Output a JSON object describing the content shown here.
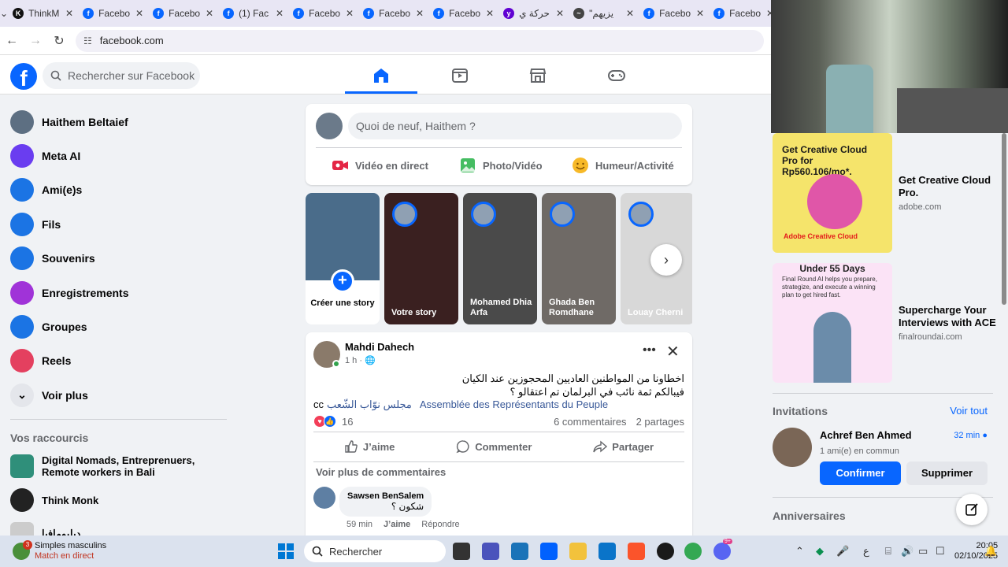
{
  "browser": {
    "tabs": [
      {
        "title": "ThinkM",
        "favicon_color": "#111111",
        "favicon_glyph": "K"
      },
      {
        "title": "Facebo",
        "favicon_color": "#0866ff",
        "favicon_glyph": "f"
      },
      {
        "title": "Facebo",
        "favicon_color": "#0866ff",
        "favicon_glyph": "f"
      },
      {
        "title": "(1) Fac",
        "favicon_color": "#0866ff",
        "favicon_glyph": "f"
      },
      {
        "title": "Facebo",
        "favicon_color": "#0866ff",
        "favicon_glyph": "f"
      },
      {
        "title": "Facebo",
        "favicon_color": "#0866ff",
        "favicon_glyph": "f"
      },
      {
        "title": "Facebo",
        "favicon_color": "#0866ff",
        "favicon_glyph": "f"
      },
      {
        "title": "حركة ي",
        "favicon_color": "#6001d2",
        "favicon_glyph": "y"
      },
      {
        "title": "\"يزيهم",
        "favicon_color": "#444444",
        "favicon_glyph": "~"
      },
      {
        "title": "Facebo",
        "favicon_color": "#0866ff",
        "favicon_glyph": "f"
      },
      {
        "title": "Facebo",
        "favicon_color": "#0866ff",
        "favicon_glyph": "f"
      }
    ],
    "url": "facebook.com"
  },
  "header": {
    "search_placeholder": "Rechercher sur Facebook",
    "nav": [
      "home-icon",
      "video-icon",
      "marketplace-icon",
      "gaming-icon"
    ]
  },
  "sidebar": {
    "items": [
      {
        "label": "Haithem Beltaief",
        "icon": "profile-avatar",
        "color": "#5d6f82"
      },
      {
        "label": "Meta AI",
        "icon": "meta-ai-icon",
        "color": "#6a3df0"
      },
      {
        "label": "Ami(e)s",
        "icon": "friends-icon",
        "color": "#1b74e4"
      },
      {
        "label": "Fils",
        "icon": "feeds-icon",
        "color": "#1b74e4"
      },
      {
        "label": "Souvenirs",
        "icon": "memories-icon",
        "color": "#1b74e4"
      },
      {
        "label": "Enregistrements",
        "icon": "saved-icon",
        "color": "#a033d8"
      },
      {
        "label": "Groupes",
        "icon": "groups-icon",
        "color": "#1b74e4"
      },
      {
        "label": "Reels",
        "icon": "reels-icon",
        "color": "#e4405f"
      },
      {
        "label": "Voir plus",
        "icon": "chevron-down-icon",
        "color": "#e4e6eb"
      }
    ],
    "shortcuts_title": "Vos raccourcis",
    "shortcuts": [
      {
        "label": "Digital Nomads, Entreprenuers, Remote workers in Bali",
        "color": "#2f8f7a"
      },
      {
        "label": "Think Monk",
        "color": "#222222"
      },
      {
        "label": "ديلبومافيا",
        "color": "#cccccc"
      }
    ]
  },
  "composer": {
    "placeholder": "Quoi de neuf, Haithem ?",
    "actions": [
      {
        "label": "Vidéo en direct",
        "icon": "live-video-icon",
        "color": "#e42645"
      },
      {
        "label": "Photo/Vidéo",
        "icon": "photo-icon",
        "color": "#45bd62"
      },
      {
        "label": "Humeur/Activité",
        "icon": "feeling-icon",
        "color": "#f7b928"
      }
    ]
  },
  "stories": {
    "create_label": "Créer une story",
    "items": [
      {
        "name": "Votre story",
        "bg": "#3a2020"
      },
      {
        "name": "Mohamed Dhia Arfa",
        "bg": "#4a4a4a"
      },
      {
        "name": "Ghada Ben Romdhane",
        "bg": "#6f6a66"
      },
      {
        "name": "Louay Cherni",
        "bg": "#d8d8d8"
      }
    ]
  },
  "post": {
    "author": "Mahdi Dahech",
    "time": "1 h · ",
    "text_line1": "اخطاونا من المواطنين العاديين المحجوزين عند الكيان",
    "text_line2": "فيبالكم ثمة نائب في البرلمان تم اعتقالو ؟",
    "tag1": "Assemblée des Représentants du Peuple",
    "tag2": "مجلس نوّاب الشّعب",
    "tag_suffix": "cc",
    "reactions_count": "16",
    "comments_count": "6 commentaires",
    "shares_count": "2 partages",
    "like_label": "J’aime",
    "comment_label": "Commenter",
    "share_label": "Partager",
    "more_comments": "Voir plus de commentaires",
    "comment": {
      "author": "Sawsen BenSalem",
      "text": "شكون ؟",
      "time": "59 min",
      "like": "J’aime",
      "reply": "Répondre"
    }
  },
  "right": {
    "ads": [
      {
        "title": "Get Creative Cloud Pro.",
        "host": "adobe.com",
        "img_headline": "Get Creative Cloud Pro for Rp560.106/mo*.",
        "img_brand": "Adobe Creative Cloud",
        "bg": "#f5e46b"
      },
      {
        "title": "Supercharge Your Interviews with ACE",
        "host": "finalroundai.com",
        "img_headline": "Under 55 Days",
        "img_body": "Final Round AI helps you prepare, strategize, and execute a winning plan to get hired fast.",
        "bg": "#fbe3f6"
      }
    ],
    "invitations_title": "Invitations",
    "see_all": "Voir tout",
    "invite": {
      "name": "Achref Ben Ahmed",
      "time": "32 min",
      "mutual": "1 ami(e) en commun",
      "confirm": "Confirmer",
      "delete": "Supprimer"
    },
    "birthdays_title": "Anniversaires"
  },
  "taskbar": {
    "live_title": "Simples masculins",
    "live_sub": "Match en direct",
    "live_badge": "3",
    "search": "Rechercher",
    "ime": "ع",
    "time": "20:05",
    "date": "02/10/2025",
    "notif_badge": "9+"
  }
}
